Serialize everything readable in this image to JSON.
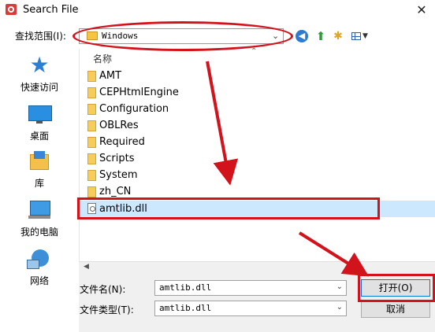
{
  "window": {
    "title": "Search File",
    "close_glyph": "✕"
  },
  "lookin": {
    "label": "查找范围(I):",
    "value": "Windows"
  },
  "places": [
    {
      "label": "快速访问",
      "icon": "star-icon"
    },
    {
      "label": "桌面",
      "icon": "desktop-icon"
    },
    {
      "label": "库",
      "icon": "library-icon"
    },
    {
      "label": "我的电脑",
      "icon": "computer-icon"
    },
    {
      "label": "网络",
      "icon": "network-icon"
    }
  ],
  "filelist": {
    "column_name": "名称",
    "items": [
      "AMT",
      "CEPHtmlEngine",
      "Configuration",
      "OBLRes",
      "Required",
      "Scripts",
      "System",
      "zh_CN"
    ],
    "selected_item": "amtlib.dll"
  },
  "filename": {
    "label": "文件名(N):",
    "value": "amtlib.dll"
  },
  "filetype": {
    "label": "文件类型(T):",
    "value": "amtlib.dll"
  },
  "buttons": {
    "open": "打开(O)",
    "cancel": "取消"
  },
  "colors": {
    "annotation": "#d2131c",
    "selection": "#cce8ff"
  }
}
